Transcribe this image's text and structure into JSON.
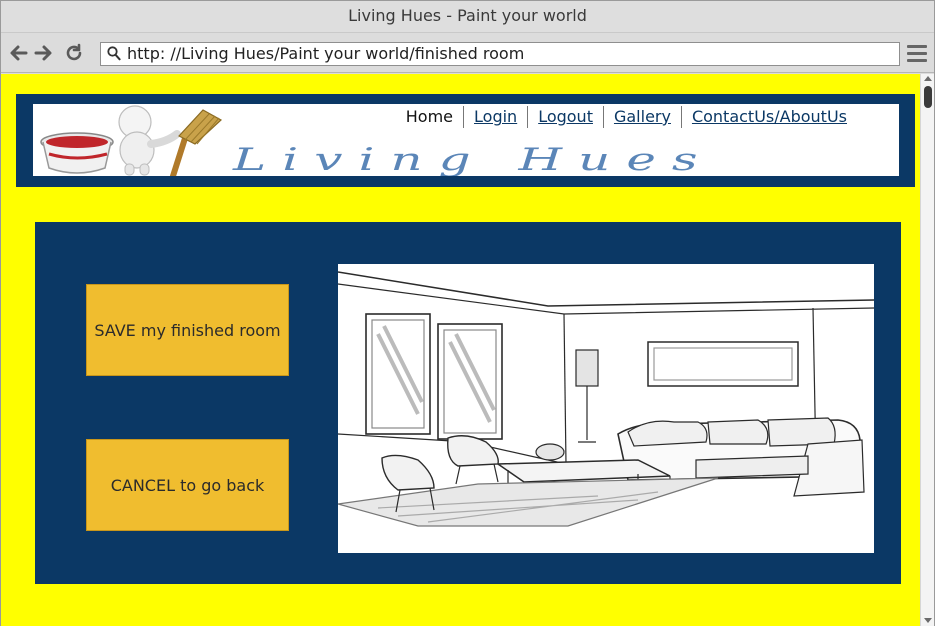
{
  "browser": {
    "window_title": "Living Hues - Paint your world",
    "url": "http: //Living Hues/Paint your world/finished room",
    "back_icon": "arrow-left-icon",
    "forward_icon": "arrow-right-icon",
    "reload_icon": "reload-icon",
    "search_icon": "search-icon",
    "menu_icon": "hamburger-menu-icon"
  },
  "header": {
    "brand": "Living Hues",
    "nav": [
      "Home",
      "Login",
      "Logout",
      "Gallery",
      "ContactUs/AboutUs"
    ]
  },
  "main": {
    "save_label": "SAVE my finished room",
    "cancel_label": "CANCEL to go back"
  },
  "colors": {
    "page_bg": "#ffff00",
    "panel": "#0b3865",
    "button": "#f0bd2f",
    "brand_text": "#5b86b8"
  }
}
